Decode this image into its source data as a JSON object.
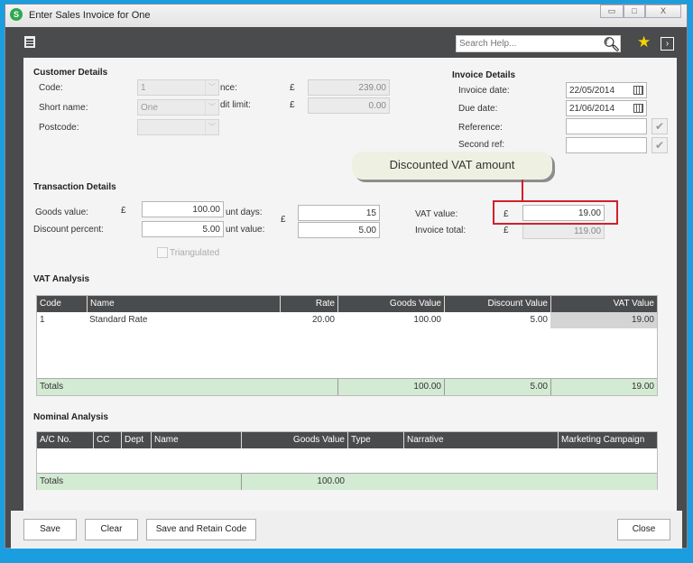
{
  "window": {
    "title": "Enter Sales Invoice for One",
    "minimize": "▭",
    "maximize": "□",
    "close": "X"
  },
  "toolbar": {
    "search_placeholder": "Search Help...",
    "menu_icon": "menu-icon",
    "search_icon": "search-icon",
    "star_icon": "star-icon",
    "expand_icon": "chevron-right-icon",
    "star_color": "#f6d200"
  },
  "customer": {
    "heading": "Customer Details",
    "code_label": "Code:",
    "code": "1",
    "short_name_label": "Short name:",
    "short_name": "One",
    "postcode_label": "Postcode:",
    "postcode": "",
    "balance_label": "nce:",
    "balance_currency": "£",
    "balance": "239.00",
    "credit_label": "dit limit:",
    "credit_currency": "£",
    "credit_limit": "0.00"
  },
  "invoice": {
    "heading": "Invoice Details",
    "invoice_date_label": "Invoice date:",
    "invoice_date": "22/05/2014",
    "due_date_label": "Due date:",
    "due_date": "21/06/2014",
    "reference_label": "Reference:",
    "reference": "",
    "second_ref_label": "Second ref:",
    "second_ref": ""
  },
  "callout": {
    "text": "Discounted VAT amount",
    "highlight_color": "#d0212b"
  },
  "transaction": {
    "heading": "Transaction Details",
    "goods_label": "Goods value:",
    "goods_currency": "£",
    "goods_value": "100.00",
    "discount_percent_label": "Discount percent:",
    "discount_percent": "5.00",
    "discount_days_label": "unt days:",
    "discount_days": "15",
    "discount_value_label": "unt value:",
    "discount_currency": "£",
    "discount_value": "5.00",
    "vat_label": "VAT value:",
    "vat_currency": "£",
    "vat_value": "19.00",
    "total_label": "Invoice total:",
    "total_currency": "£",
    "invoice_total": "119.00",
    "triangulated_label": "Triangulated",
    "triangulated": false
  },
  "vat_analysis": {
    "heading": "VAT Analysis",
    "columns": [
      "Code",
      "Name",
      "Rate",
      "Goods Value",
      "Discount Value",
      "VAT Value"
    ],
    "rows": [
      [
        "1",
        "Standard Rate",
        "20.00",
        "100.00",
        "5.00",
        "19.00"
      ]
    ],
    "totals": {
      "label": "Totals",
      "goods": "100.00",
      "discount": "5.00",
      "vat": "19.00"
    }
  },
  "nominal_analysis": {
    "heading": "Nominal Analysis",
    "columns": [
      "A/C No.",
      "CC",
      "Dept",
      "Name",
      "Goods Value",
      "Type",
      "Narrative",
      "Marketing Campaign"
    ],
    "totals": {
      "label": "Totals",
      "goods": "100.00"
    }
  },
  "buttons": {
    "save": "Save",
    "clear": "Clear",
    "save_retain": "Save and Retain Code",
    "close": "Close"
  }
}
